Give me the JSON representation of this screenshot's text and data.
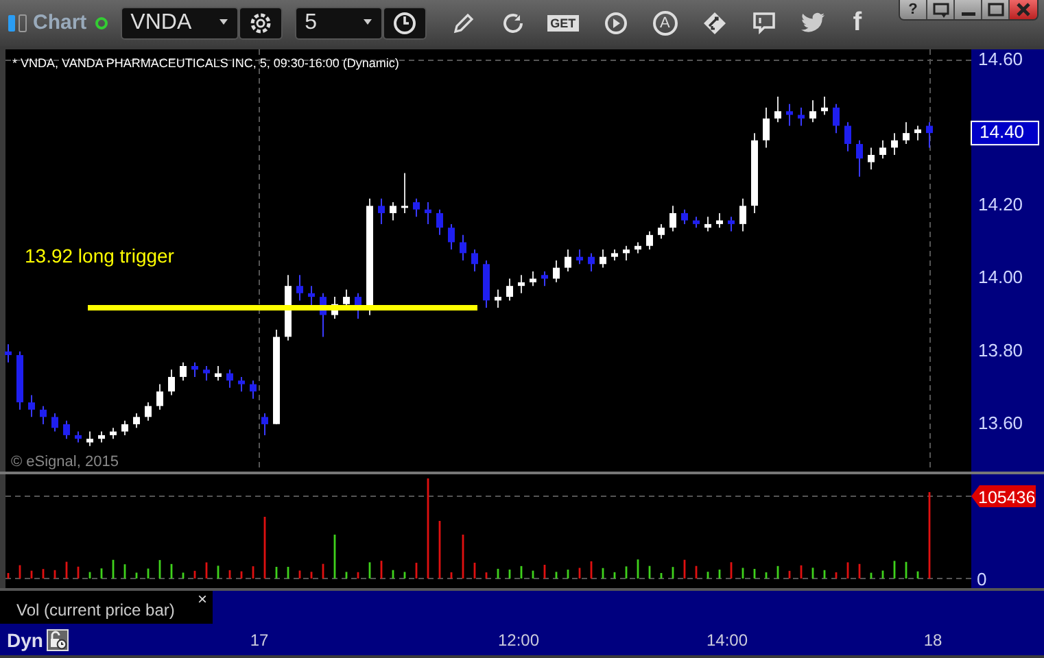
{
  "toolbar": {
    "title": "Chart",
    "symbol": "VNDA",
    "interval": "5",
    "get_label": "GET",
    "a_label": "A",
    "facebook_label": "f",
    "help_label": "?"
  },
  "chart_header": "* VNDA, VANDA PHARMACEUTICALS INC, 5, 09:30-16:00 (Dynamic)",
  "copyright": "© eSignal, 2015",
  "price_tag": {
    "label": "14.40"
  },
  "chart_data": {
    "type": "candlestick",
    "ylim": [
      13.47,
      14.63
    ],
    "yticks": [
      {
        "value": 14.6,
        "label": "14.60"
      },
      {
        "value": 14.2,
        "label": "14.20"
      },
      {
        "value": 14.0,
        "label": "14.00"
      },
      {
        "value": 13.8,
        "label": "13.80"
      },
      {
        "value": 13.6,
        "label": "13.60"
      }
    ],
    "ref_lines": [
      {
        "axis": "y",
        "value": 13.92,
        "label": "13.92 long trigger",
        "color": "#ffff00"
      }
    ],
    "categories": [
      null,
      null,
      null,
      null,
      null,
      null,
      null,
      null,
      null,
      null,
      null,
      null,
      null,
      null,
      null,
      null,
      null,
      null,
      null,
      null,
      null,
      null,
      null,
      null,
      null,
      null,
      null,
      null,
      null,
      null,
      null,
      null,
      null,
      null,
      null,
      null,
      null,
      null,
      null,
      null,
      null,
      null,
      null,
      null,
      null,
      null,
      null,
      null,
      null,
      null,
      null,
      null,
      null,
      null,
      null,
      null,
      null,
      null,
      null,
      null,
      null,
      null,
      null,
      null,
      null,
      null,
      null,
      null,
      null,
      null,
      null,
      null,
      null,
      null,
      null,
      null,
      null,
      null,
      null,
      null
    ],
    "ohlc": [
      [
        13.8,
        13.82,
        13.77,
        13.79
      ],
      [
        13.79,
        13.8,
        13.64,
        13.66
      ],
      [
        13.66,
        13.68,
        13.62,
        13.64
      ],
      [
        13.64,
        13.65,
        13.6,
        13.62
      ],
      [
        13.62,
        13.63,
        13.58,
        13.59
      ],
      [
        13.6,
        13.61,
        13.56,
        13.57
      ],
      [
        13.57,
        13.58,
        13.55,
        13.56
      ],
      [
        13.55,
        13.58,
        13.54,
        13.56
      ],
      [
        13.56,
        13.58,
        13.55,
        13.57
      ],
      [
        13.57,
        13.59,
        13.56,
        13.58
      ],
      [
        13.58,
        13.61,
        13.57,
        13.6
      ],
      [
        13.6,
        13.63,
        13.59,
        13.62
      ],
      [
        13.62,
        13.66,
        13.61,
        13.65
      ],
      [
        13.65,
        13.71,
        13.64,
        13.69
      ],
      [
        13.69,
        13.75,
        13.68,
        13.73
      ],
      [
        13.73,
        13.77,
        13.72,
        13.76
      ],
      [
        13.76,
        13.77,
        13.73,
        13.75
      ],
      [
        13.75,
        13.76,
        13.72,
        13.74
      ],
      [
        13.73,
        13.76,
        13.72,
        13.74
      ],
      [
        13.74,
        13.75,
        13.7,
        13.72
      ],
      [
        13.72,
        13.73,
        13.69,
        13.71
      ],
      [
        13.71,
        13.72,
        13.67,
        13.69
      ],
      [
        13.62,
        13.63,
        13.57,
        13.6
      ],
      [
        13.6,
        13.86,
        13.6,
        13.84
      ],
      [
        13.84,
        14.01,
        13.83,
        13.98
      ],
      [
        13.98,
        14.01,
        13.94,
        13.96
      ],
      [
        13.96,
        13.98,
        13.92,
        13.95
      ],
      [
        13.95,
        13.96,
        13.84,
        13.9
      ],
      [
        13.9,
        13.95,
        13.89,
        13.93
      ],
      [
        13.93,
        13.97,
        13.92,
        13.95
      ],
      [
        13.95,
        13.96,
        13.89,
        13.92
      ],
      [
        13.92,
        14.22,
        13.9,
        14.2
      ],
      [
        14.2,
        14.22,
        14.15,
        14.18
      ],
      [
        14.18,
        14.21,
        14.16,
        14.2
      ],
      [
        14.2,
        14.29,
        14.18,
        14.2
      ],
      [
        14.21,
        14.22,
        14.17,
        14.19
      ],
      [
        14.19,
        14.21,
        14.15,
        14.18
      ],
      [
        14.18,
        14.19,
        14.12,
        14.14
      ],
      [
        14.14,
        14.15,
        14.08,
        14.1
      ],
      [
        14.1,
        14.12,
        14.05,
        14.07
      ],
      [
        14.07,
        14.08,
        14.02,
        14.04
      ],
      [
        14.04,
        14.05,
        13.92,
        13.94
      ],
      [
        13.94,
        13.97,
        13.92,
        13.95
      ],
      [
        13.95,
        14.0,
        13.94,
        13.98
      ],
      [
        13.98,
        14.01,
        13.96,
        13.99
      ],
      [
        13.99,
        14.02,
        13.98,
        14.0
      ],
      [
        14.01,
        14.02,
        13.98,
        14.0
      ],
      [
        14.0,
        14.05,
        13.99,
        14.03
      ],
      [
        14.03,
        14.08,
        14.02,
        14.06
      ],
      [
        14.06,
        14.08,
        14.04,
        14.05
      ],
      [
        14.06,
        14.07,
        14.02,
        14.04
      ],
      [
        14.04,
        14.08,
        14.03,
        14.06
      ],
      [
        14.06,
        14.08,
        14.05,
        14.07
      ],
      [
        14.07,
        14.09,
        14.05,
        14.08
      ],
      [
        14.08,
        14.1,
        14.07,
        14.09
      ],
      [
        14.09,
        14.13,
        14.08,
        14.12
      ],
      [
        14.12,
        14.15,
        14.11,
        14.14
      ],
      [
        14.14,
        14.2,
        14.13,
        14.18
      ],
      [
        14.18,
        14.19,
        14.15,
        14.16
      ],
      [
        14.16,
        14.17,
        14.14,
        14.15
      ],
      [
        14.14,
        14.17,
        14.13,
        14.15
      ],
      [
        14.15,
        14.18,
        14.14,
        14.16
      ],
      [
        14.16,
        14.17,
        14.13,
        14.15
      ],
      [
        14.15,
        14.22,
        14.13,
        14.2
      ],
      [
        14.2,
        14.4,
        14.18,
        14.38
      ],
      [
        14.38,
        14.47,
        14.36,
        14.44
      ],
      [
        14.44,
        14.5,
        14.43,
        14.46
      ],
      [
        14.46,
        14.48,
        14.42,
        14.45
      ],
      [
        14.45,
        14.47,
        14.42,
        14.44
      ],
      [
        14.44,
        14.49,
        14.43,
        14.46
      ],
      [
        14.46,
        14.5,
        14.45,
        14.47
      ],
      [
        14.47,
        14.48,
        14.4,
        14.42
      ],
      [
        14.42,
        14.43,
        14.35,
        14.37
      ],
      [
        14.37,
        14.38,
        14.28,
        14.33
      ],
      [
        14.32,
        14.36,
        14.3,
        14.34
      ],
      [
        14.34,
        14.38,
        14.33,
        14.36
      ],
      [
        14.36,
        14.4,
        14.34,
        14.38
      ],
      [
        14.38,
        14.43,
        14.37,
        14.4
      ],
      [
        14.4,
        14.42,
        14.38,
        14.41
      ],
      [
        14.42,
        14.43,
        14.36,
        14.4
      ]
    ]
  },
  "volume_axis": [
    {
      "label": "105436",
      "kind": "current"
    },
    {
      "label": "0",
      "kind": "tick"
    }
  ],
  "study_legend": {
    "label": "Vol (current price bar)",
    "close": "×"
  },
  "bottom_bar": {
    "mode": "Dyn",
    "time_labels": [
      "17",
      "12:00",
      "14:00",
      "18"
    ]
  }
}
